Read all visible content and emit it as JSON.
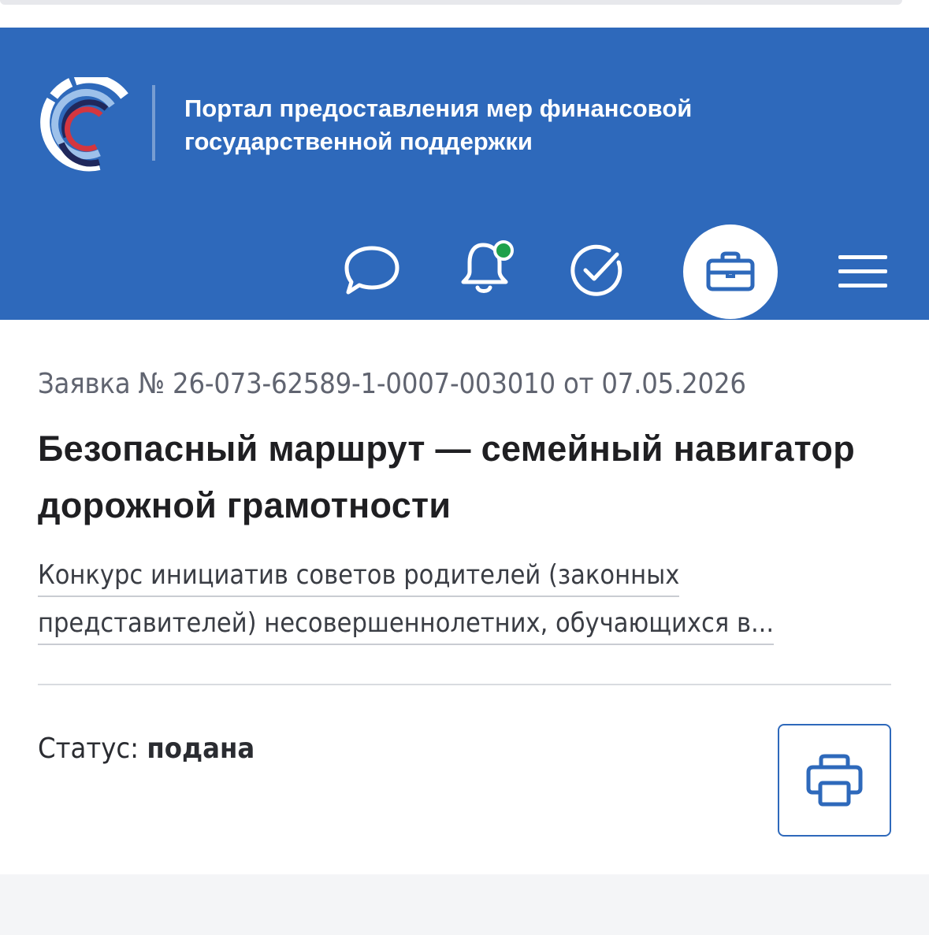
{
  "header": {
    "portal_title": "Портал предоставления мер финансовой государственной поддержки",
    "colors": {
      "background": "#2e69bb",
      "notification_dot": "#1fa14b"
    },
    "icons": [
      "logo-icon",
      "chat-icon",
      "bell-icon",
      "check-circle-icon",
      "briefcase-icon",
      "menu-icon"
    ]
  },
  "application": {
    "number_line": "Заявка № 26-073-62589-1-0007-003010 от 07.05.2026",
    "title": "Безопасный маршрут — семейный навигатор дорожной грамотности",
    "contest_line_1": "Конкурс инициатив советов родителей (законных",
    "contest_line_2": "представителей) несовершеннолетних, обучающихся в...",
    "status_label": "Статус:",
    "status_value": "подана",
    "print_icon": "printer-icon"
  }
}
